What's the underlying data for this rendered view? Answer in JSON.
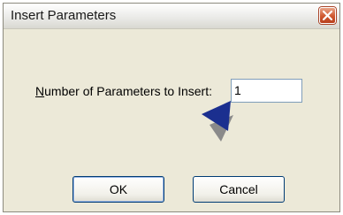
{
  "window": {
    "title": "Insert Parameters",
    "close_icon": "close-icon"
  },
  "form": {
    "label_mnemonic": "N",
    "label_rest": "umber of Parameters to Insert:",
    "value": "1"
  },
  "buttons": {
    "ok_label": "OK",
    "cancel_label": "Cancel"
  },
  "colors": {
    "pointer_arrow": "#1b2f8f",
    "close_button": "#d0572f"
  }
}
